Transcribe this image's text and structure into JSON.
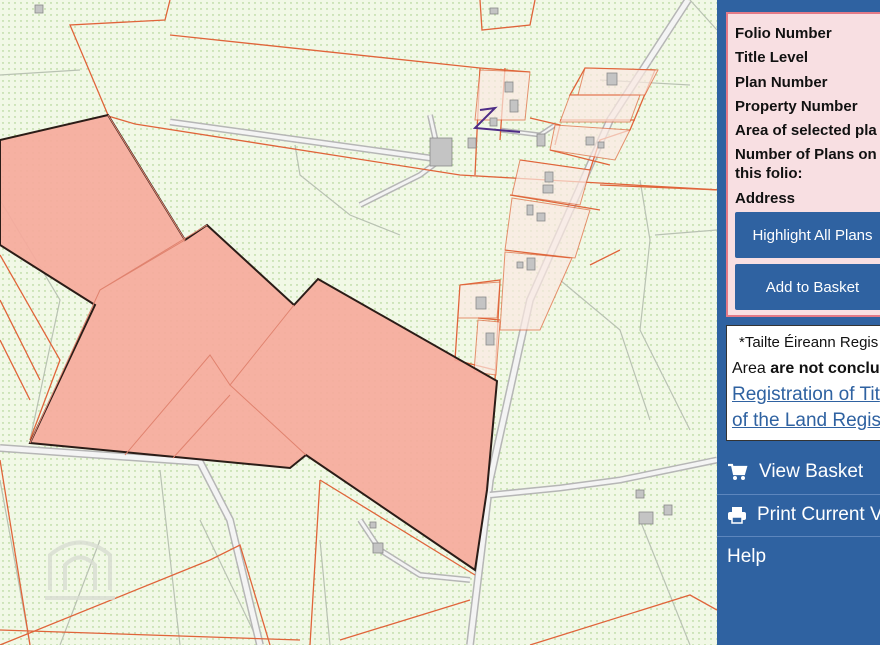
{
  "panel": {
    "fields": {
      "folio_number": "Folio Number",
      "title_level": "Title Level",
      "plan_number": "Plan Number",
      "property_number": "Property Number",
      "area_selected": "Area of selected pla",
      "num_plans_line1": "Number of Plans on",
      "num_plans_line2": "this folio:",
      "address": "Address"
    },
    "buttons": {
      "highlight_all": "Highlight All Plans",
      "add_to_basket": "Add to Basket"
    },
    "notice": {
      "line1": "*Tailte Éireann Regis",
      "line2_prefix": "Area ",
      "line2_bold": "are not conclu",
      "link_line1": "Registration of Tit",
      "link_line2": "of the Land Regist"
    },
    "menu": {
      "view_basket": "View Basket",
      "print_current": "Print Current V",
      "help": "Help"
    }
  },
  "colors": {
    "panel_blue": "#2f62a1",
    "selected_plan_fill": "#f6aa9c",
    "plan_boundary": "#e0643a",
    "map_background": "#f1f8e6"
  },
  "icons": {
    "basket": "shopping-cart-icon",
    "print": "printer-icon",
    "north": "north-arrow-icon"
  }
}
